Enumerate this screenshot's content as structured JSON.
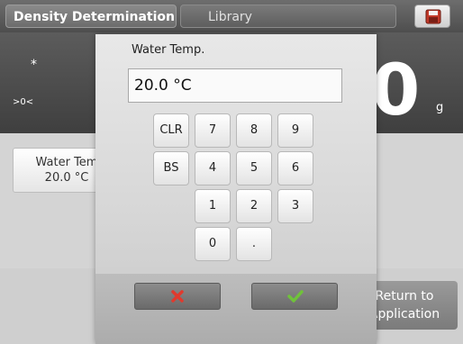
{
  "header": {
    "active_tab": "Density Determination",
    "library_tab": "Library",
    "save_icon": "floppy-disk-icon"
  },
  "weighing": {
    "stable_indicator": "*",
    "zero_indicator": ">0<",
    "reading_digit": "0",
    "unit": "g"
  },
  "parameters": {
    "water_temp_label": "Water Tem",
    "water_temp_value": "20.0 °C"
  },
  "footer": {
    "return_label_line1": "Return to",
    "return_label_line2": "Application"
  },
  "dialog": {
    "title": "Water Temp.",
    "input_value": "20.0 °C",
    "keys": {
      "clr": "CLR",
      "bs": "BS",
      "k7": "7",
      "k8": "8",
      "k9": "9",
      "k4": "4",
      "k5": "5",
      "k6": "6",
      "k1": "1",
      "k2": "2",
      "k3": "3",
      "k0": "0",
      "dot": "."
    },
    "cancel_icon": "red-x-icon",
    "ok_icon": "green-check-icon"
  },
  "colors": {
    "cancel": "#e03a2e",
    "confirm": "#6fc23a"
  }
}
